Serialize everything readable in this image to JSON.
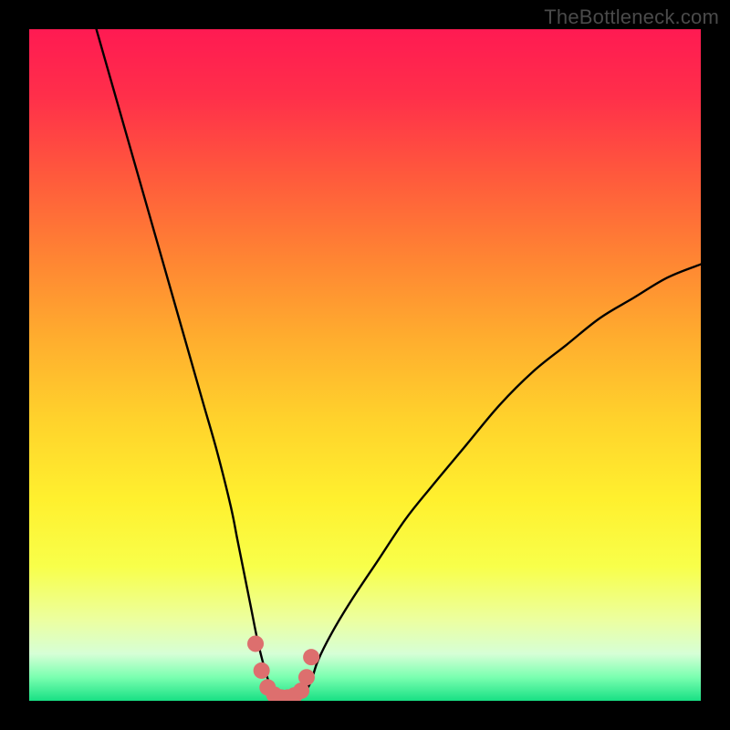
{
  "watermark": "TheBottleneck.com",
  "colors": {
    "frame": "#000000",
    "gradient_stops": [
      {
        "offset": 0.0,
        "color": "#ff1a52"
      },
      {
        "offset": 0.1,
        "color": "#ff2f4a"
      },
      {
        "offset": 0.22,
        "color": "#ff5a3c"
      },
      {
        "offset": 0.34,
        "color": "#ff8433"
      },
      {
        "offset": 0.46,
        "color": "#ffad2e"
      },
      {
        "offset": 0.58,
        "color": "#ffd22c"
      },
      {
        "offset": 0.7,
        "color": "#fff02e"
      },
      {
        "offset": 0.8,
        "color": "#f8ff4a"
      },
      {
        "offset": 0.88,
        "color": "#ecffa0"
      },
      {
        "offset": 0.93,
        "color": "#d6ffd6"
      },
      {
        "offset": 0.965,
        "color": "#7affb0"
      },
      {
        "offset": 1.0,
        "color": "#18e084"
      }
    ],
    "curve": "#000000",
    "accent": "#dd6f6e"
  },
  "chart_data": {
    "type": "line",
    "title": "",
    "xlabel": "",
    "ylabel": "",
    "xlim": [
      0,
      100
    ],
    "ylim": [
      0,
      100
    ],
    "series": [
      {
        "name": "bottleneck-curve",
        "x": [
          10,
          12,
          14,
          16,
          18,
          20,
          22,
          24,
          26,
          28,
          30,
          31,
          32,
          33,
          34,
          35,
          36,
          37,
          38,
          39,
          40,
          41,
          42,
          43,
          45,
          48,
          52,
          56,
          60,
          65,
          70,
          75,
          80,
          85,
          90,
          95,
          100
        ],
        "y": [
          100,
          93,
          86,
          79,
          72,
          65,
          58,
          51,
          44,
          37,
          29,
          24,
          19,
          14,
          9,
          5,
          2,
          0.8,
          0.4,
          0.4,
          0.6,
          1.2,
          3,
          6,
          10,
          15,
          21,
          27,
          32,
          38,
          44,
          49,
          53,
          57,
          60,
          63,
          65
        ]
      }
    ],
    "accent_region": {
      "name": "optimal-range-markers",
      "x": [
        33.7,
        34.6,
        35.5,
        36.5,
        37.5,
        38.5,
        39.5,
        40.5,
        41.3,
        42.0
      ],
      "y": [
        8.5,
        4.5,
        2.0,
        0.9,
        0.5,
        0.5,
        0.8,
        1.5,
        3.5,
        6.5
      ]
    }
  }
}
